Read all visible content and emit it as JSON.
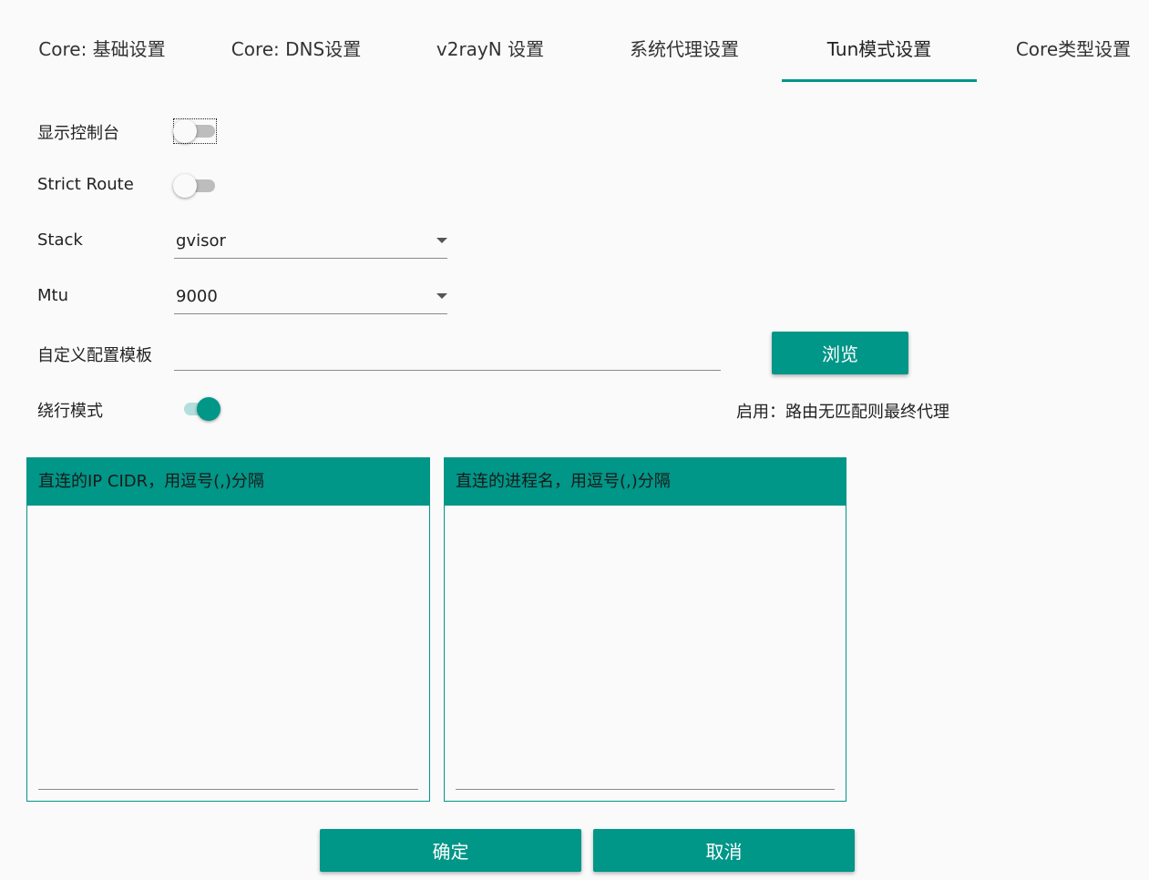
{
  "tabs": [
    {
      "label": "Core: 基础设置"
    },
    {
      "label": "Core: DNS设置"
    },
    {
      "label": "v2rayN 设置"
    },
    {
      "label": "系统代理设置"
    },
    {
      "label": "Tun模式设置"
    },
    {
      "label": "Core类型设置"
    }
  ],
  "active_tab": "Tun模式设置",
  "form": {
    "show_console": {
      "label": "显示控制台",
      "on": false
    },
    "strict_route": {
      "label": "Strict Route",
      "on": false
    },
    "stack": {
      "label": "Stack",
      "value": "gvisor"
    },
    "mtu": {
      "label": "Mtu",
      "value": "9000"
    },
    "custom_template": {
      "label": "自定义配置模板",
      "value": "",
      "browse_label": "浏览"
    },
    "bypass_mode": {
      "label": "绕行模式",
      "on": true,
      "hint": "启用：路由无匹配则最终代理"
    }
  },
  "panels": {
    "direct_ip": {
      "title": "直连的IP CIDR，用逗号(,)分隔",
      "value": ""
    },
    "direct_process": {
      "title": "直连的进程名，用逗号(,)分隔",
      "value": ""
    }
  },
  "footer": {
    "ok_label": "确定",
    "cancel_label": "取消"
  },
  "colors": {
    "accent": "#009688",
    "accent_light": "#b2dfdb",
    "background": "#fafafa"
  }
}
